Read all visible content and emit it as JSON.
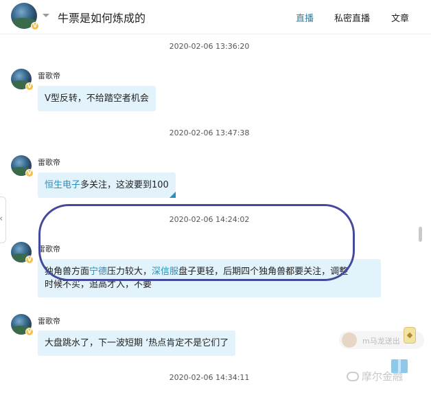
{
  "header": {
    "title": "牛票是如何炼成的",
    "nav": [
      "直播",
      "私密直播",
      "文章"
    ]
  },
  "messages": [
    {
      "time": "2020-02-06 13:36:20"
    },
    {
      "time": "2020-02-06 13:47:38",
      "author": "雷歌帝",
      "text": "V型反转，不给踏空者机会"
    },
    {
      "time": "2020-02-06 14:24:02",
      "author": "雷歌帝",
      "parts": [
        "恒生电子",
        "多关注，这波要到100"
      ]
    },
    {
      "author": "雷歌帝",
      "parts": [
        "独角兽方面",
        "宁德",
        "压力较大，",
        "深信服",
        "盘子更轻，后期四个独角兽都要关注，调整",
        "时候不买，追高才入，不要"
      ]
    },
    {
      "author": "雷歌帝",
      "text": "大盘跳水了，下一波短期 ‘热点肯定不是它们了"
    },
    {
      "time": "2020-02-06 14:34:11"
    }
  ],
  "gift_pill": {
    "text": "m马龙送出"
  },
  "watermark": "摩尔金融",
  "colors": {
    "accent": "#2c7fa8",
    "bubble": "#e3f3fc",
    "stock_link": "#2a8fbd",
    "highlight_ring": "#434a9c"
  },
  "icons": [
    "dropdown-caret-icon",
    "verified-v-icon",
    "gift-icon",
    "chevron-left-icon"
  ]
}
